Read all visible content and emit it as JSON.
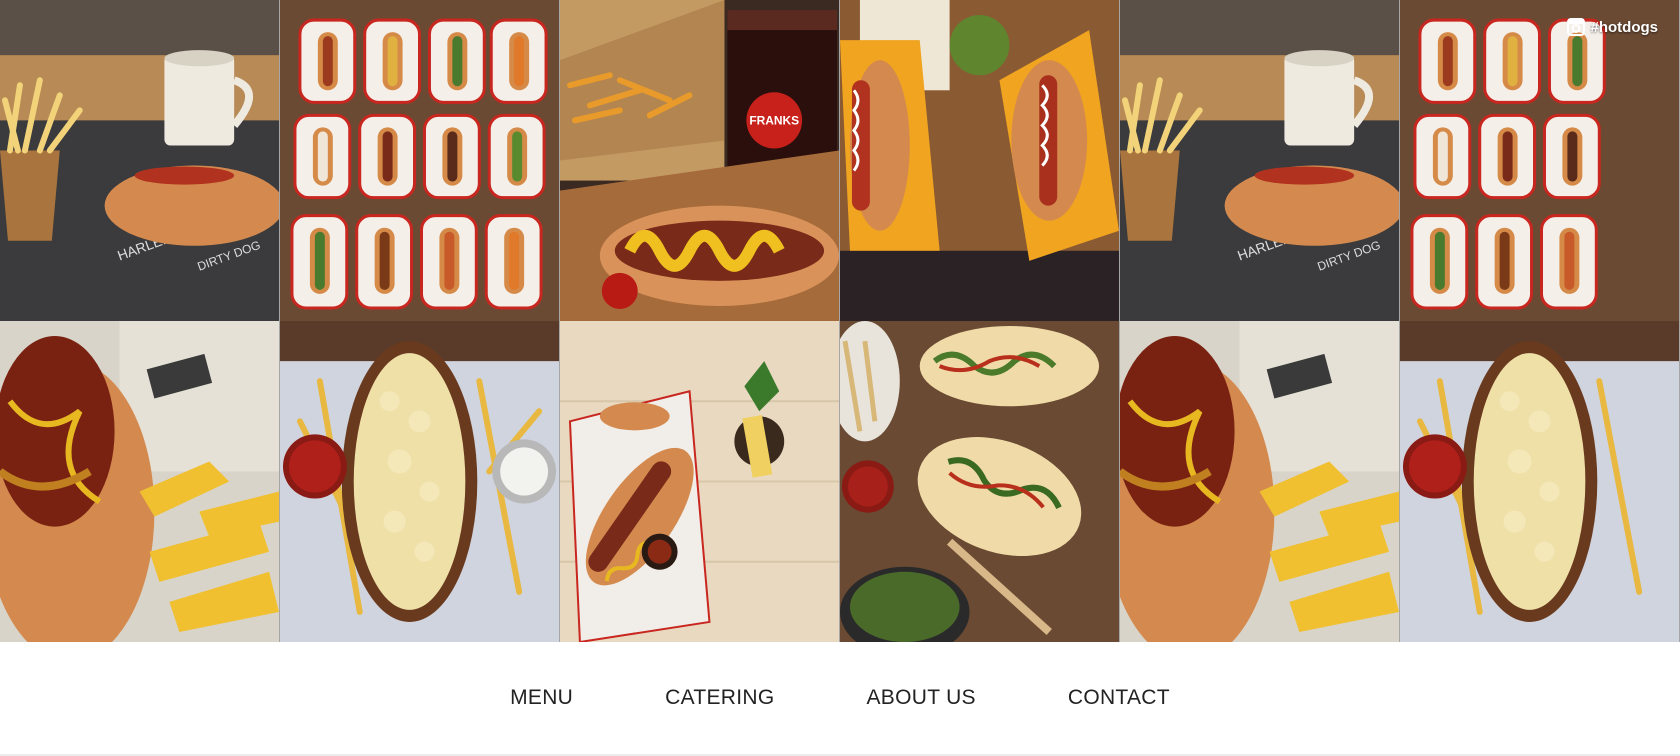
{
  "instagram": {
    "hashtag": "#hotdogs",
    "icon": "instagram-icon"
  },
  "gallery": {
    "tiles": [
      {
        "subject": "hotdog-with-fries-and-coffee"
      },
      {
        "subject": "twelve-hotdogs-in-paper-trays"
      },
      {
        "subject": "chili-cheese-dog-and-cola"
      },
      {
        "subject": "hotdogs-on-orange-trays"
      },
      {
        "subject": "hotdog-with-fries-and-coffee"
      },
      {
        "subject": "twelve-hotdogs-in-paper-trays"
      },
      {
        "subject": "bacon-cheese-dog-with-fries"
      },
      {
        "subject": "mac-and-cheese-dog"
      },
      {
        "subject": "mustard-dog-with-cocktail"
      },
      {
        "subject": "loaded-bread-dogs-on-board"
      },
      {
        "subject": "bacon-cheese-dog-with-fries"
      },
      {
        "subject": "mac-and-cheese-dog"
      }
    ]
  },
  "nav": {
    "items": [
      {
        "label": "MENU"
      },
      {
        "label": "CATERING"
      },
      {
        "label": "ABOUT US"
      },
      {
        "label": "CONTACT"
      }
    ]
  },
  "colors": {
    "nav_text": "#222222",
    "bun": "#d9925a",
    "sausage": "#8b2a1a",
    "ketchup": "#c0201a",
    "mustard": "#e8b820"
  }
}
